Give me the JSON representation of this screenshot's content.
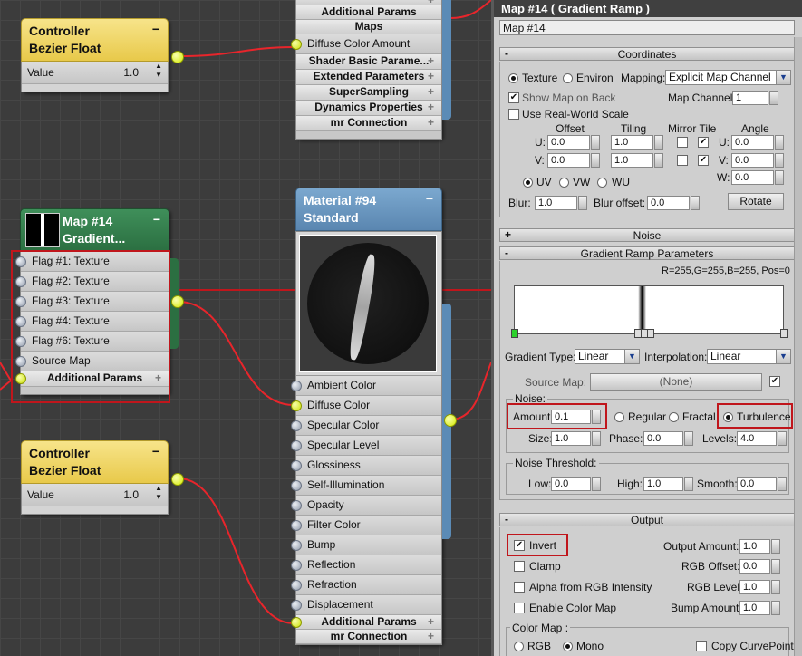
{
  "graph": {
    "controller_top": {
      "title1": "Controller",
      "title2": "Bezier Float",
      "value_label": "Value",
      "value": "1.0"
    },
    "controller_bottom": {
      "title1": "Controller",
      "title2": "Bezier Float",
      "value_label": "Value",
      "value": "1.0"
    },
    "map_node": {
      "title1": "Map #14",
      "title2": "Gradient...",
      "slots": [
        "Flag #1: Texture",
        "Flag #2: Texture",
        "Flag #3: Texture",
        "Flag #4: Texture",
        "Flag #6: Texture",
        "Source Map"
      ],
      "sub_label": "Additional Params"
    },
    "top_material": {
      "slots": [
        "Additional Params",
        "Maps"
      ],
      "map_slot": "Diffuse Color Amount",
      "subs": [
        "Shader Basic Parame...",
        "Extended Parameters",
        "SuperSampling",
        "Dynamics Properties",
        "mr Connection"
      ]
    },
    "material": {
      "title1": "Material #94",
      "title2": "Standard",
      "slots": [
        "Ambient Color",
        "Diffuse Color",
        "Specular Color",
        "Specular Level",
        "Glossiness",
        "Self-Illumination",
        "Opacity",
        "Filter Color",
        "Bump",
        "Reflection",
        "Refraction",
        "Displacement"
      ],
      "subs": [
        "Additional Params",
        "mr Connection"
      ]
    }
  },
  "panel": {
    "title": "Map #14  ( Gradient Ramp )",
    "name": "Map #14",
    "coordinates": {
      "header": "Coordinates",
      "texture": "Texture",
      "environ": "Environ",
      "mapping_label": "Mapping:",
      "mapping": "Explicit Map Channel",
      "show_map": "Show Map on Back",
      "map_channel_label": "Map Channel:",
      "map_channel": "1",
      "real_world": "Use Real-World Scale",
      "offset": "Offset",
      "tiling": "Tiling",
      "mirror_tile": "Mirror Tile",
      "angle": "Angle",
      "u": "U:",
      "v": "V:",
      "w": "W:",
      "u_offset": "0.0",
      "v_offset": "0.0",
      "u_tiling": "1.0",
      "v_tiling": "1.0",
      "u_angle": "0.0",
      "v_angle": "0.0",
      "w_angle": "0.0",
      "uv": "UV",
      "vw": "VW",
      "wu": "WU",
      "blur_label": "Blur:",
      "blur": "1.0",
      "blur_offset_label": "Blur offset:",
      "blur_offset": "0.0",
      "rotate": "Rotate"
    },
    "noise_header": "Noise",
    "gradient": {
      "header": "Gradient Ramp Parameters",
      "readout": "R=255,G=255,B=255, Pos=0",
      "type_label": "Gradient Type:",
      "type": "Linear",
      "interp_label": "Interpolation:",
      "interp": "Linear",
      "source_map_label": "Source Map:",
      "source_map": "(None)",
      "noise_group": "Noise:",
      "amount_label": "Amount:",
      "amount": "0.1",
      "regular": "Regular",
      "fractal": "Fractal",
      "turbulence": "Turbulence",
      "size_label": "Size:",
      "size": "1.0",
      "phase_label": "Phase:",
      "phase": "0.0",
      "levels_label": "Levels:",
      "levels": "4.0",
      "threshold_group": "Noise Threshold:",
      "low_label": "Low:",
      "low": "0.0",
      "high_label": "High:",
      "high": "1.0",
      "smooth_label": "Smooth:",
      "smooth": "0.0"
    },
    "output": {
      "header": "Output",
      "invert": "Invert",
      "clamp": "Clamp",
      "alpha": "Alpha from RGB Intensity",
      "enable_color_map": "Enable Color Map",
      "output_amount_label": "Output Amount:",
      "output_amount": "1.0",
      "rgb_offset_label": "RGB Offset:",
      "rgb_offset": "0.0",
      "rgb_level_label": "RGB Level:",
      "rgb_level": "1.0",
      "bump_amount_label": "Bump Amount:",
      "bump_amount": "1.0",
      "color_map_group": "Color Map :",
      "rgb": "RGB",
      "mono": "Mono",
      "copy_curve": "Copy CurvePoints"
    }
  }
}
